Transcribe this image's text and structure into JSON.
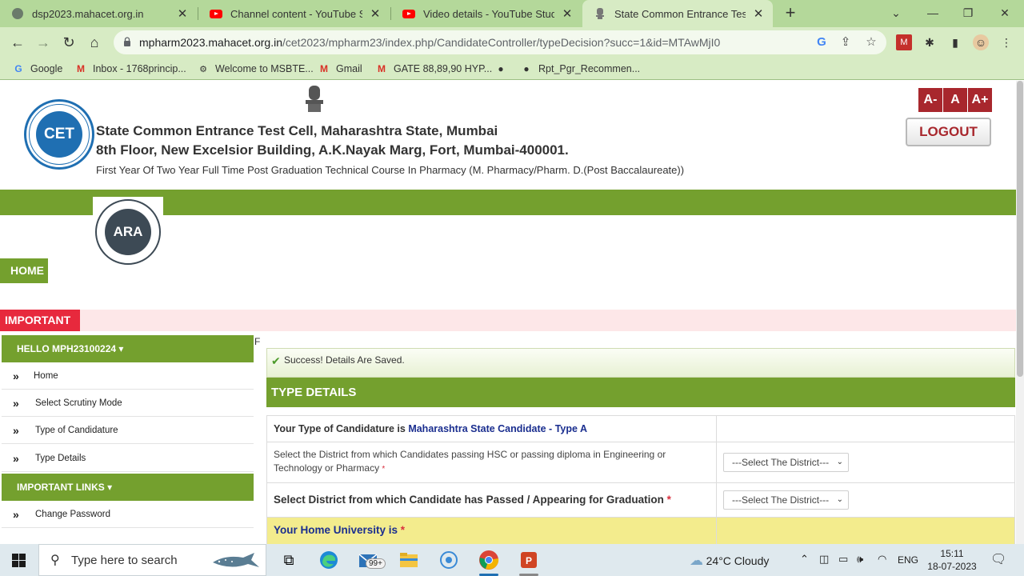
{
  "browser": {
    "tabs": [
      {
        "title": "dsp2023.mahacet.org.in",
        "icon": "globe-icon",
        "active": false
      },
      {
        "title": "Channel content - YouTube Studio",
        "icon": "youtube-icon",
        "active": false
      },
      {
        "title": "Video details - YouTube Studio",
        "icon": "youtube-icon",
        "active": false
      },
      {
        "title": "State Common Entrance Test Cell",
        "icon": "emblem-icon",
        "active": true
      }
    ],
    "url_host": "mpharm2023.mahacet.org.in",
    "url_path": "/cet2023/mpharm23/index.php/CandidateController/typeDecision?succ=1&id=MTAwMjI0",
    "bookmarks": [
      {
        "label": "Google",
        "icon": "google-icon"
      },
      {
        "label": "Inbox - 1768princip...",
        "icon": "gmail-icon"
      },
      {
        "label": "Welcome to MSBTE...",
        "icon": "msbte-icon"
      },
      {
        "label": "Gmail",
        "icon": "gmail-icon"
      },
      {
        "label": "GATE 88,89,90 HYP...",
        "icon": "gmail-icon"
      },
      {
        "label": "",
        "icon": "github-icon"
      },
      {
        "label": "Rpt_Pgr_Recommen...",
        "icon": "github-icon"
      }
    ],
    "theme_color": "#b4d89a"
  },
  "header": {
    "org_line1": "State Common Entrance Test Cell, Maharashtra State, Mumbai",
    "org_line2": "8th Floor, New Excelsior Building, A.K.Nayak Marg, Fort, Mumbai-400001.",
    "course": "First Year Of Two Year Full Time Post Graduation Technical Course In Pharmacy (M. Pharmacy/Pharm. D.(Post Baccalaureate))",
    "cet_logo_text": "CET",
    "ara_logo_text": "ARA",
    "font_buttons": [
      "A-",
      "A",
      "A+"
    ],
    "logout_label": "LOGOUT"
  },
  "nav": {
    "home_label": "HOME",
    "important_label": "IMPORTANT"
  },
  "sidebar": {
    "user_heading": "HELLO MPH23100224",
    "items": [
      {
        "label": "Home"
      },
      {
        "label": "Select Scrutiny Mode"
      },
      {
        "label": "Type of Candidature"
      },
      {
        "label": "Type Details"
      }
    ],
    "links_heading": "IMPORTANT LINKS",
    "links": [
      {
        "label": "Change Password"
      }
    ]
  },
  "main": {
    "stray_text": "F",
    "success_message": "Success! Details Are Saved.",
    "section_title": "TYPE DETAILS",
    "candidature_prefix": "Your Type of Candidature is ",
    "candidature_value": "Maharashtra State Candidate - Type A",
    "q1_label": "Select the District from which Candidates passing HSC or passing diploma in Engineering or Technology or Pharmacy ",
    "q1_select": "---Select The District---",
    "q2_label": "Select District from which Candidate has Passed / Appearing for Graduation ",
    "q2_select": "---Select The District---",
    "q3_label": "Your Home University is ",
    "required_mark": "*",
    "accent_green": "#74a02e",
    "accent_red": "#e7293d"
  },
  "taskbar": {
    "search_placeholder": "Type here to search",
    "mail_badge": "99+",
    "weather": "24°C  Cloudy",
    "language": "ENG",
    "time": "15:11",
    "date": "18-07-2023"
  }
}
